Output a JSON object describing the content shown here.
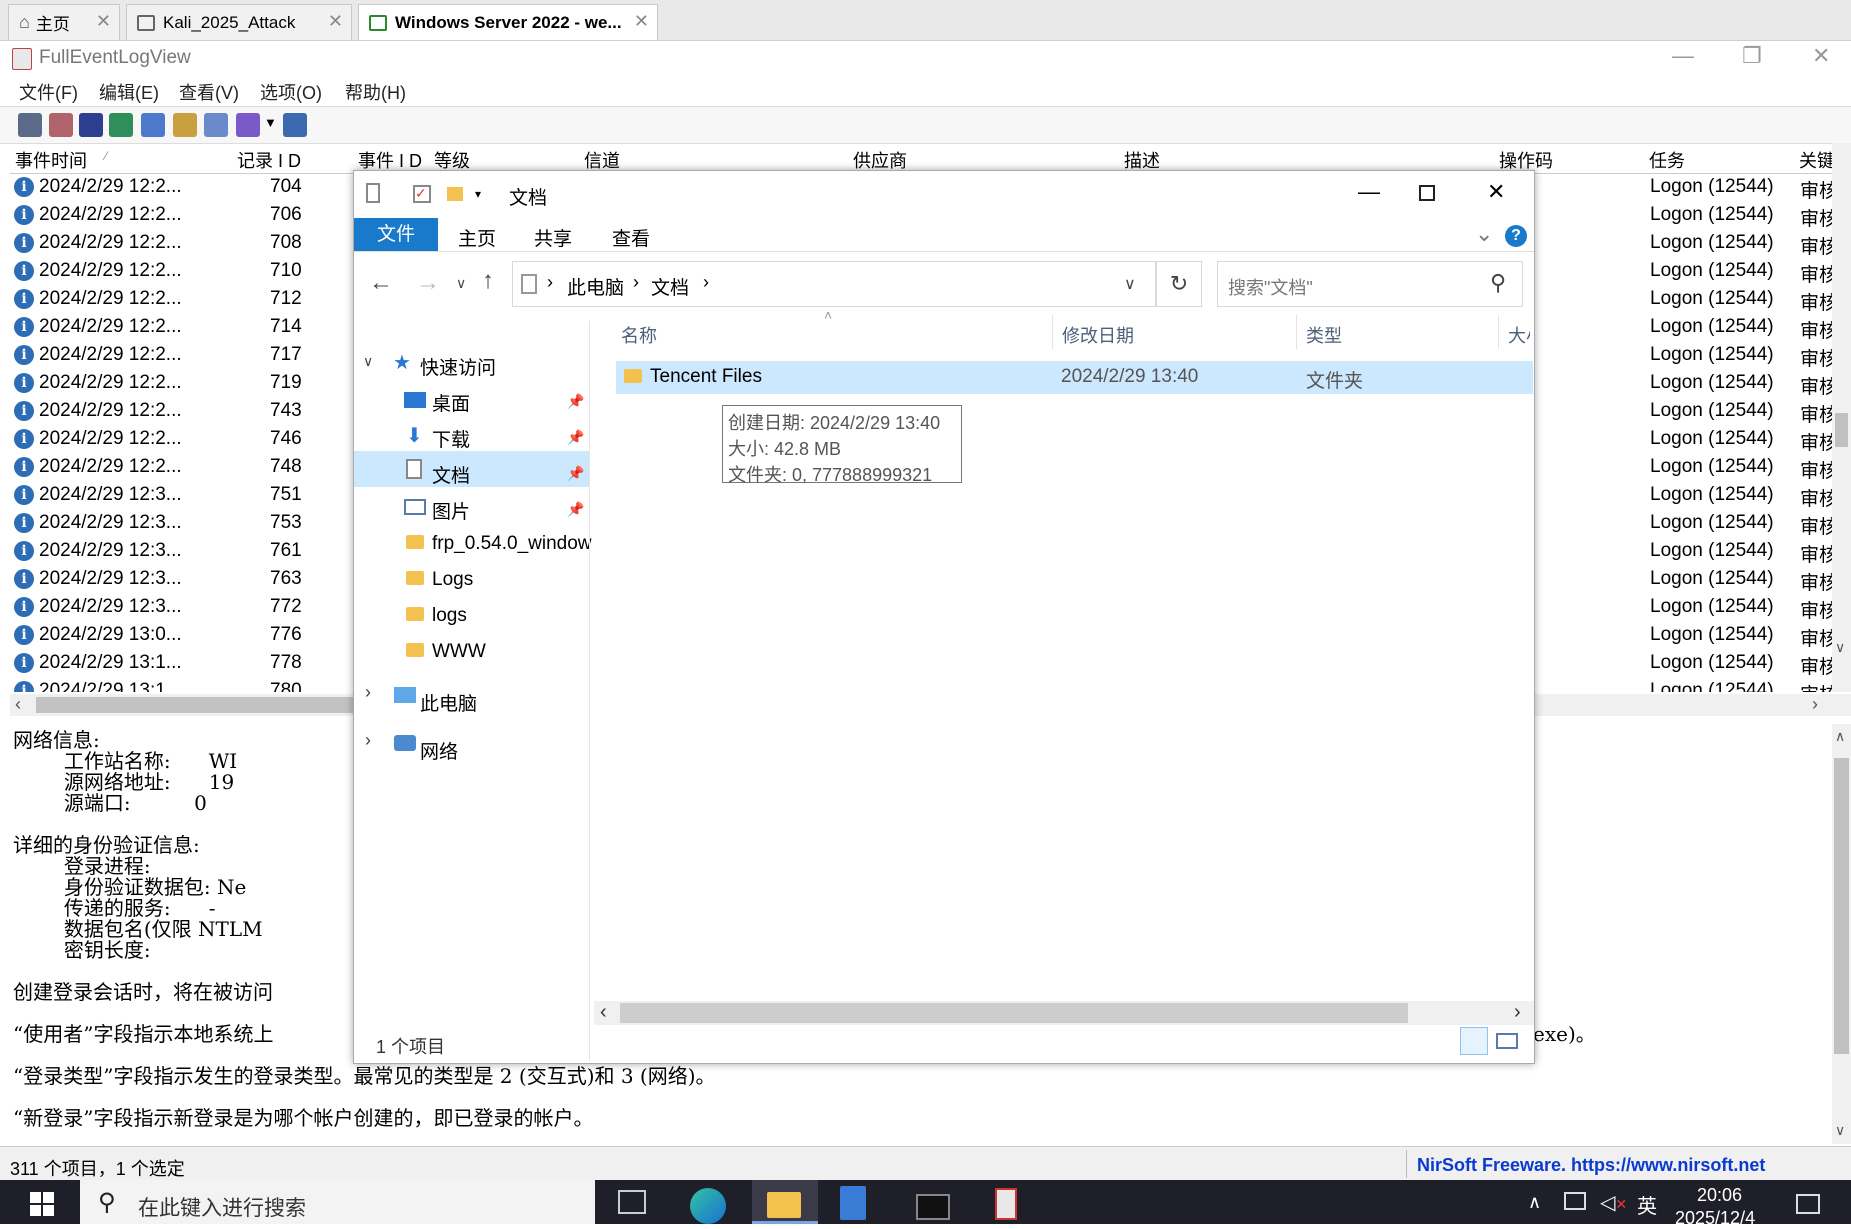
{
  "vm_tabs": [
    {
      "label": "主页"
    },
    {
      "label": "Kali_2025_Attack"
    },
    {
      "label": "Windows Server 2022 - we..."
    }
  ],
  "app": {
    "title": "FullEventLogView",
    "menu": [
      "文件(F)",
      "编辑(E)",
      "查看(V)",
      "选项(O)",
      "帮助(H)"
    ]
  },
  "list": {
    "columns": [
      "事件时间",
      "记录 I D",
      "事件 I D",
      "等级",
      "信道",
      "供应商",
      "描述",
      "操作码",
      "任务",
      "关键"
    ],
    "rows": [
      {
        "time": "2024/2/29 12:2...",
        "record": "704",
        "task": "Logon (12544)",
        "key": "审核"
      },
      {
        "time": "2024/2/29 12:2...",
        "record": "706",
        "task": "Logon (12544)",
        "key": "审核"
      },
      {
        "time": "2024/2/29 12:2...",
        "record": "708",
        "task": "Logon (12544)",
        "key": "审核"
      },
      {
        "time": "2024/2/29 12:2...",
        "record": "710",
        "task": "Logon (12544)",
        "key": "审核"
      },
      {
        "time": "2024/2/29 12:2...",
        "record": "712",
        "task": "Logon (12544)",
        "key": "审核"
      },
      {
        "time": "2024/2/29 12:2...",
        "record": "714",
        "task": "Logon (12544)",
        "key": "审核"
      },
      {
        "time": "2024/2/29 12:2...",
        "record": "717",
        "task": "Logon (12544)",
        "key": "审核"
      },
      {
        "time": "2024/2/29 12:2...",
        "record": "719",
        "task": "Logon (12544)",
        "key": "审核"
      },
      {
        "time": "2024/2/29 12:2...",
        "record": "743",
        "task": "Logon (12544)",
        "key": "审核"
      },
      {
        "time": "2024/2/29 12:2...",
        "record": "746",
        "task": "Logon (12544)",
        "key": "审核"
      },
      {
        "time": "2024/2/29 12:2...",
        "record": "748",
        "task": "Logon (12544)",
        "key": "审核"
      },
      {
        "time": "2024/2/29 12:3...",
        "record": "751",
        "task": "Logon (12544)",
        "key": "审核"
      },
      {
        "time": "2024/2/29 12:3...",
        "record": "753",
        "task": "Logon (12544)",
        "key": "审核"
      },
      {
        "time": "2024/2/29 12:3...",
        "record": "761",
        "task": "Logon (12544)",
        "key": "审核"
      },
      {
        "time": "2024/2/29 12:3...",
        "record": "763",
        "task": "Logon (12544)",
        "key": "审核"
      },
      {
        "time": "2024/2/29 12:3...",
        "record": "772",
        "task": "Logon (12544)",
        "key": "审核"
      },
      {
        "time": "2024/2/29 13:0...",
        "record": "776",
        "task": "Logon (12544)",
        "key": "审核"
      },
      {
        "time": "2024/2/29 13:1...",
        "record": "778",
        "task": "Logon (12544)",
        "key": "审核"
      },
      {
        "time": "2024/2/29 13:1...",
        "record": "780",
        "task": "Logon (12544)",
        "key": "审核"
      }
    ]
  },
  "detail": {
    "lines": [
      "网络信息:",
      "        工作站名称:      WI",
      "        源网络地址:      19",
      "        源端口:          0",
      "",
      "详细的身份验证信息:",
      "        登录进程:",
      "        身份验证数据包: Ne",
      "        传递的服务:      -",
      "        数据包名(仅限 NTLM",
      "        密钥长度:",
      "",
      "创建登录会话时，将在被访问",
      "",
      "“使用者”字段指示本地系统上",
      "",
      "“登录类型”字段指示发生的登录类型。最常见的类型是 2 (交互式)和 3 (网络)。",
      "",
      "“新登录”字段指示新登录是为哪个帐户创建的，即已登录的帐户。"
    ],
    "tail": "exe)。"
  },
  "status": {
    "count": "311 个项目，1 个选定",
    "link": "NirSoft Freeware. https://www.nirsoft.net"
  },
  "taskbar": {
    "search_placeholder": "在此键入进行搜索",
    "ime": "英",
    "time": "20:06",
    "date": "2025/12/4"
  },
  "explorer": {
    "title": "文档",
    "ribbon_tabs": [
      "文件",
      "主页",
      "共享",
      "查看"
    ],
    "breadcrumb": [
      "此电脑",
      "文档"
    ],
    "search_placeholder": "搜索\"文档\"",
    "nav": {
      "quick_access": "快速访问",
      "items": [
        "桌面",
        "下载",
        "文档",
        "图片",
        "frp_0.54.0_window",
        "Logs",
        "logs",
        "WWW"
      ],
      "this_pc": "此电脑",
      "network": "网络"
    },
    "columns": [
      "名称",
      "修改日期",
      "类型",
      "大小"
    ],
    "files": [
      {
        "name": "Tencent Files",
        "modified": "2024/2/29 13:40",
        "type": "文件夹"
      }
    ],
    "tooltip": [
      "创建日期: 2024/2/29 13:40",
      "大小: 42.8 MB",
      "文件夹: 0, 777888999321"
    ],
    "status": "1 个项目"
  },
  "colors": {
    "ribbon_accent": "#1979ca",
    "selection": "#cce8ff",
    "link": "#0a3ad0",
    "taskbar": "#1f1f2a"
  }
}
